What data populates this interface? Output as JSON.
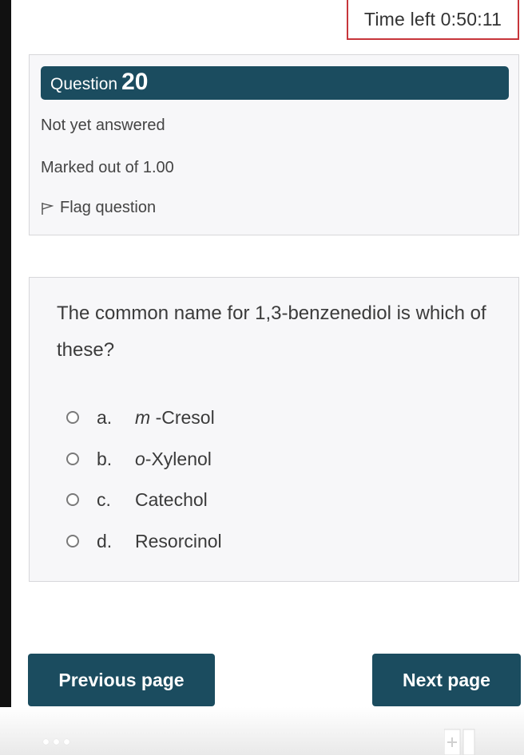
{
  "timer": {
    "text": "Time left 0:50:11"
  },
  "question_info": {
    "label": "Question",
    "number": "20",
    "state": "Not yet answered",
    "marks": "Marked out of 1.00",
    "flag_label": "Flag question"
  },
  "question": {
    "text": "The common name for 1,3-benzenediol is which of these?",
    "answers": [
      {
        "letter": "a.",
        "prefix": "m",
        "text": "-Cresol"
      },
      {
        "letter": "b.",
        "prefix": "o",
        "text": "-Xylenol"
      },
      {
        "letter": "c.",
        "prefix": "",
        "text": "Catechol"
      },
      {
        "letter": "d.",
        "prefix": "",
        "text": "Resorcinol"
      }
    ]
  },
  "nav": {
    "previous_label": "Previous page",
    "next_label": "Next page"
  },
  "colors": {
    "header_bg": "#1b4c5f",
    "timer_border": "#c7353b",
    "card_bg": "#f7f7f9"
  },
  "icons": {
    "flag": "flag-icon",
    "radio": "radio-icon",
    "more": "more-dots-icon",
    "add": "plus-icon"
  }
}
